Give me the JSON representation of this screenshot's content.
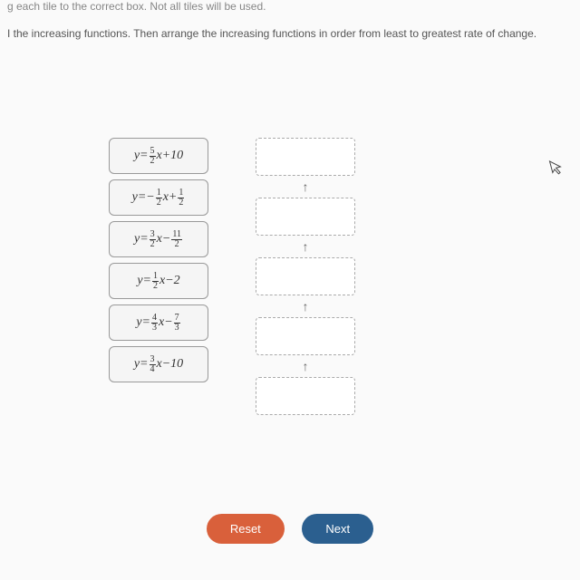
{
  "header": {
    "line1": "g each tile to the correct box. Not all tiles will be used.",
    "line2": "I the increasing functions. Then arrange the increasing functions in order from least to greatest rate of change."
  },
  "tiles": [
    {
      "y": "y",
      "eq": "=",
      "num": "5",
      "den": "2",
      "xop": "x+10"
    },
    {
      "y": "y",
      "eq": "=",
      "pre": "−",
      "num": "1",
      "den": "2",
      "xop": "x+",
      "num2": "1",
      "den2": "2"
    },
    {
      "y": "y",
      "eq": "=",
      "num": "3",
      "den": "2",
      "xop": "x−",
      "num2": "11",
      "den2": "2"
    },
    {
      "y": "y",
      "eq": "=",
      "num": "1",
      "den": "2",
      "xop": "x−2"
    },
    {
      "y": "y",
      "eq": "=",
      "num": "4",
      "den": "3",
      "xop": "x−",
      "num2": "7",
      "den2": "3"
    },
    {
      "y": "y",
      "eq": "=",
      "num": "3",
      "den": "4",
      "xop": "x−10"
    }
  ],
  "arrow": "↑",
  "buttons": {
    "reset": "Reset",
    "next": "Next"
  }
}
